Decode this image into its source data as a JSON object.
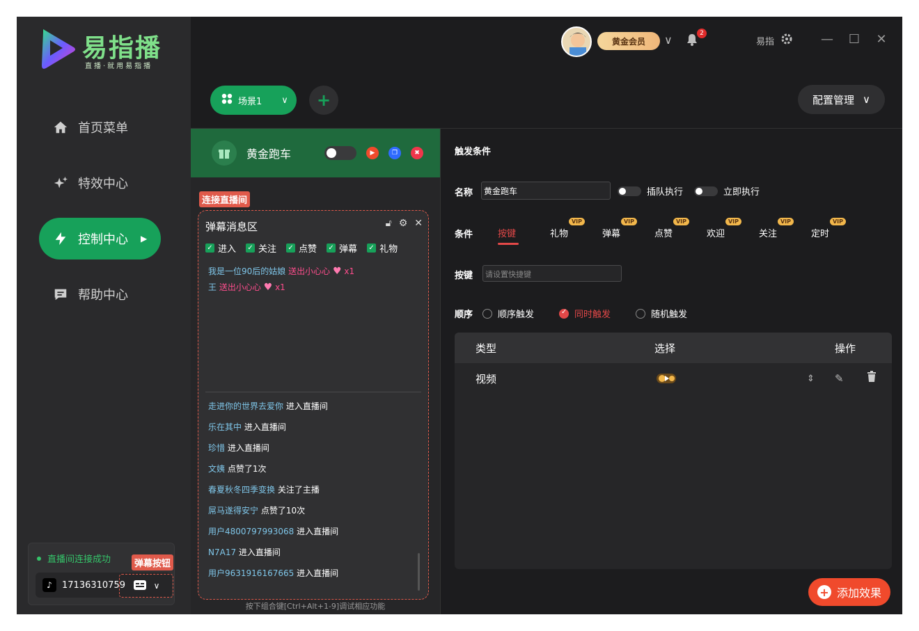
{
  "logo": {
    "title": "易指播",
    "subtitle": "直播·就用易指播"
  },
  "sidebar": {
    "items": [
      {
        "label": "首页菜单",
        "icon": "home-icon"
      },
      {
        "label": "特效中心",
        "icon": "sparkle-icon"
      },
      {
        "label": "控制中心",
        "icon": "lightning-icon",
        "active": true
      },
      {
        "label": "帮助中心",
        "icon": "chat-icon"
      }
    ],
    "connection": {
      "status": "直播间连接成功",
      "account": "17136310759",
      "danmu_tag": "弹幕按钮"
    }
  },
  "header": {
    "vip_label": "黄金会员",
    "notification_count": "2",
    "user_name": "易指"
  },
  "toolbar": {
    "scene_label": "场景1",
    "config_label": "配置管理"
  },
  "effect": {
    "name": "黄金跑车",
    "enabled": false
  },
  "live_tag": "连接直播间",
  "messages": {
    "title": "弹幕消息区",
    "filters": [
      "进入",
      "关注",
      "点赞",
      "弹幕",
      "礼物"
    ],
    "gifts": [
      {
        "user": "我是一位90后的姑娘",
        "action": "送出小心心",
        "count": "x1"
      },
      {
        "user": "王",
        "action": "送出小心心",
        "count": "x1"
      }
    ],
    "events": [
      {
        "user": "走进你的世界去爱你",
        "action": "进入直播间"
      },
      {
        "user": "乐在其中",
        "action": "进入直播间"
      },
      {
        "user": "珍惜",
        "action": "进入直播间"
      },
      {
        "user": "文姨",
        "action": "点赞了1次"
      },
      {
        "user": "春夏秋冬四季变换",
        "action": "关注了主播"
      },
      {
        "user": "屌马遂得安宁",
        "action": "点赞了10次"
      },
      {
        "user": "用户4800797993068",
        "action": "进入直播间"
      },
      {
        "user": "N7A17",
        "action": "进入直播间"
      },
      {
        "user": "用户9631916167665",
        "action": "进入直播间"
      }
    ],
    "hint": "按下组合键[Ctrl+Alt+1-9]调试相应功能"
  },
  "trigger": {
    "section_title": "触发条件",
    "name_label": "名称",
    "name_value": "黄金跑车",
    "queue_label": "插队执行",
    "immediate_label": "立即执行",
    "condition_label": "条件",
    "conditions": [
      {
        "label": "按键",
        "active": true,
        "vip": false
      },
      {
        "label": "礼物",
        "vip": true
      },
      {
        "label": "弹幕",
        "vip": true
      },
      {
        "label": "点赞",
        "vip": true
      },
      {
        "label": "欢迎",
        "vip": true
      },
      {
        "label": "关注",
        "vip": true
      },
      {
        "label": "定时",
        "vip": true
      }
    ],
    "vip_mini": "VIP",
    "key_label": "按键",
    "key_placeholder": "请设置快捷键",
    "order_label": "顺序",
    "orders": [
      {
        "label": "顺序触发",
        "selected": false
      },
      {
        "label": "同时触发",
        "selected": true
      },
      {
        "label": "随机触发",
        "selected": false
      }
    ]
  },
  "table": {
    "headers": [
      "类型",
      "选择",
      "操作"
    ],
    "rows": [
      {
        "type": "视频"
      }
    ]
  },
  "add_effect_label": "添加效果"
}
